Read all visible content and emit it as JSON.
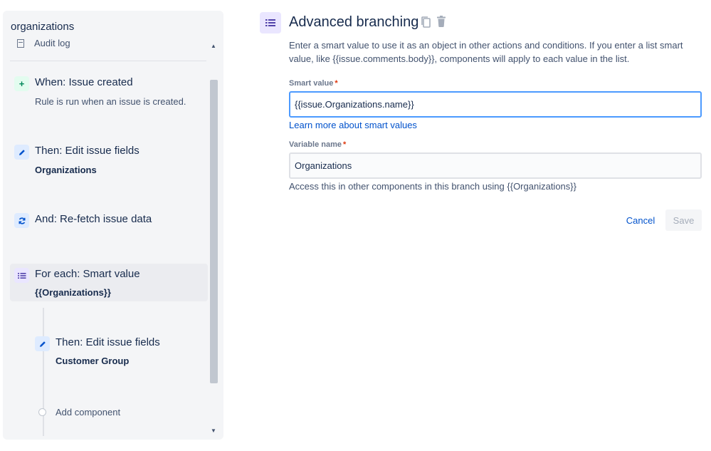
{
  "sidebar": {
    "title": "organizations",
    "audit_log": "Audit log",
    "components": [
      {
        "title": "When: Issue created",
        "detail": "Rule is run when an issue is created."
      },
      {
        "title": "Then: Edit issue fields",
        "detail": "Organizations"
      },
      {
        "title": "And: Re-fetch issue data",
        "detail": ""
      },
      {
        "title": "For each: Smart value",
        "detail": "{{Organizations}}"
      },
      {
        "title": "Then: Edit issue fields",
        "detail": "Customer Group"
      }
    ],
    "add_component": "Add component"
  },
  "editor": {
    "title": "Advanced branching",
    "description": "Enter a smart value to use it as an object in other actions and conditions. If you enter a list smart value, like {{issue.comments.body}}, components will apply to each value in the list.",
    "smart_value_label": "Smart value",
    "smart_value": "{{issue.Organizations.name}}",
    "learn_more": "Learn more about smart values",
    "variable_name_label": "Variable name",
    "variable_name": "Organizations",
    "variable_help": "Access this in other components in this branch using {{Organizations}}",
    "required_marker": "*",
    "cancel_label": "Cancel",
    "save_label": "Save"
  },
  "icons": {
    "trigger": "plus-icon",
    "edit": "pencil-icon",
    "refetch": "refresh-icon",
    "branch": "list-icon",
    "copy": "copy-icon",
    "delete": "trash-icon"
  },
  "colors": {
    "accent": "#0052cc",
    "focus_border": "#4c9aff",
    "branch_bg": "#eae6ff",
    "trigger_bg": "#e3fcef",
    "action_bg": "#deebff"
  }
}
